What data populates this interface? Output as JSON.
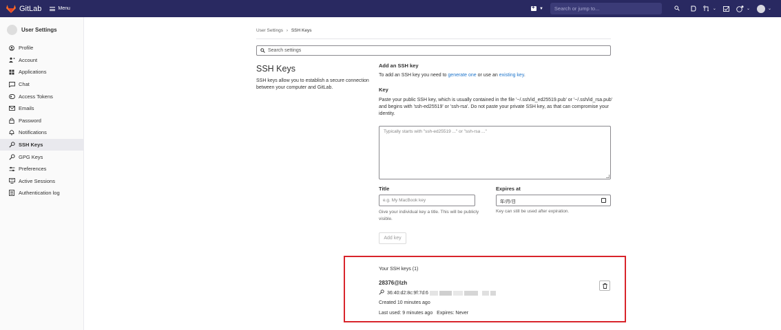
{
  "navbar": {
    "brand": "GitLab",
    "menu_label": "Menu",
    "search_placeholder": "Search or jump to...",
    "icons": [
      "plus-square-icon",
      "search-icon",
      "issues-icon",
      "merge-request-icon",
      "todo-icon",
      "help-icon",
      "avatar"
    ]
  },
  "sidebar": {
    "title": "User Settings",
    "items": [
      {
        "label": "Profile",
        "icon": "profile-icon"
      },
      {
        "label": "Account",
        "icon": "account-icon"
      },
      {
        "label": "Applications",
        "icon": "applications-icon"
      },
      {
        "label": "Chat",
        "icon": "chat-icon"
      },
      {
        "label": "Access Tokens",
        "icon": "token-icon"
      },
      {
        "label": "Emails",
        "icon": "email-icon"
      },
      {
        "label": "Password",
        "icon": "lock-icon"
      },
      {
        "label": "Notifications",
        "icon": "bell-icon"
      },
      {
        "label": "SSH Keys",
        "icon": "key-icon",
        "active": true
      },
      {
        "label": "GPG Keys",
        "icon": "key-icon"
      },
      {
        "label": "Preferences",
        "icon": "preferences-icon"
      },
      {
        "label": "Active Sessions",
        "icon": "monitor-icon"
      },
      {
        "label": "Authentication log",
        "icon": "log-icon"
      }
    ]
  },
  "breadcrumb": {
    "parent": "User Settings",
    "separator": "›",
    "current": "SSH Keys"
  },
  "settings_search": {
    "placeholder": "Search settings"
  },
  "section": {
    "title": "SSH Keys",
    "description": "SSH keys allow you to establish a secure connection between your computer and GitLab."
  },
  "form": {
    "add_heading": "Add an SSH key",
    "intro_prefix": "To add an SSH key you need to ",
    "intro_link1": "generate one",
    "intro_mid": " or use an ",
    "intro_link2": "existing key",
    "intro_suffix": ".",
    "key_label": "Key",
    "key_help": "Paste your public SSH key, which is usually contained in the file '~/.ssh/id_ed25519.pub' or '~/.ssh/id_rsa.pub' and begins with 'ssh-ed25519' or 'ssh-rsa'. Do not paste your private SSH key, as that can compromise your identity.",
    "key_placeholder": "Typically starts with \"ssh-ed25519 ...\" or \"ssh-rsa ...\"",
    "title_label": "Title",
    "title_placeholder": "e.g. My MacBook key",
    "title_help": "Give your individual key a title. This will be publicly visible.",
    "expires_label": "Expires at",
    "expires_value": "年/月/日",
    "expires_help": "Key can still be used after expiration.",
    "add_button": "Add key"
  },
  "keys": {
    "heading": "Your SSH keys (1)",
    "items": [
      {
        "name": "28376@lzh",
        "fingerprint": "36:40:d2:8c:9f:7d:6",
        "created": "Created 10 minutes ago",
        "last_used": "Last used: 9 minutes ago",
        "expires": "Expires: Never"
      }
    ]
  },
  "colors": {
    "navbar": "#292961",
    "link": "#1f75cb",
    "highlight_border": "#d8232a"
  }
}
